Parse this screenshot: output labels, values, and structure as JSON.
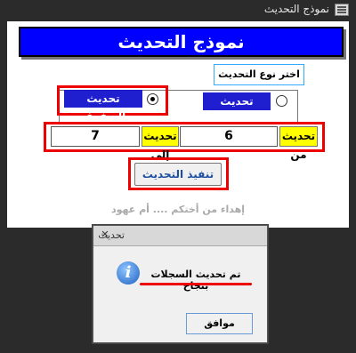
{
  "window": {
    "title": "نموذج التحديث"
  },
  "form": {
    "banner_title": "نموذج التحديث",
    "group_title": "اختر نوع التحديث",
    "option_years": "تحديث الأعوام",
    "option_grades": "تحديث الصفوف",
    "selected_option": "تحديث الصفوف",
    "update_from_label": "تحديث من",
    "update_from_value": "6",
    "update_to_label": "تحديث إلى",
    "update_to_value": "7",
    "execute_button": "تنفيذ التحديث",
    "footer_text": "إهداء من أختكم .... أم عهود"
  },
  "dialog": {
    "title": "تحديث",
    "message": "تم تحديث السجلات بنجاح",
    "ok_button": "موافق",
    "close_glyph": "✕",
    "icon_glyph": "i"
  },
  "colors": {
    "banner": "#0000ff",
    "highlight_frame": "#ee0000",
    "label_yellow": "#ffff00"
  }
}
